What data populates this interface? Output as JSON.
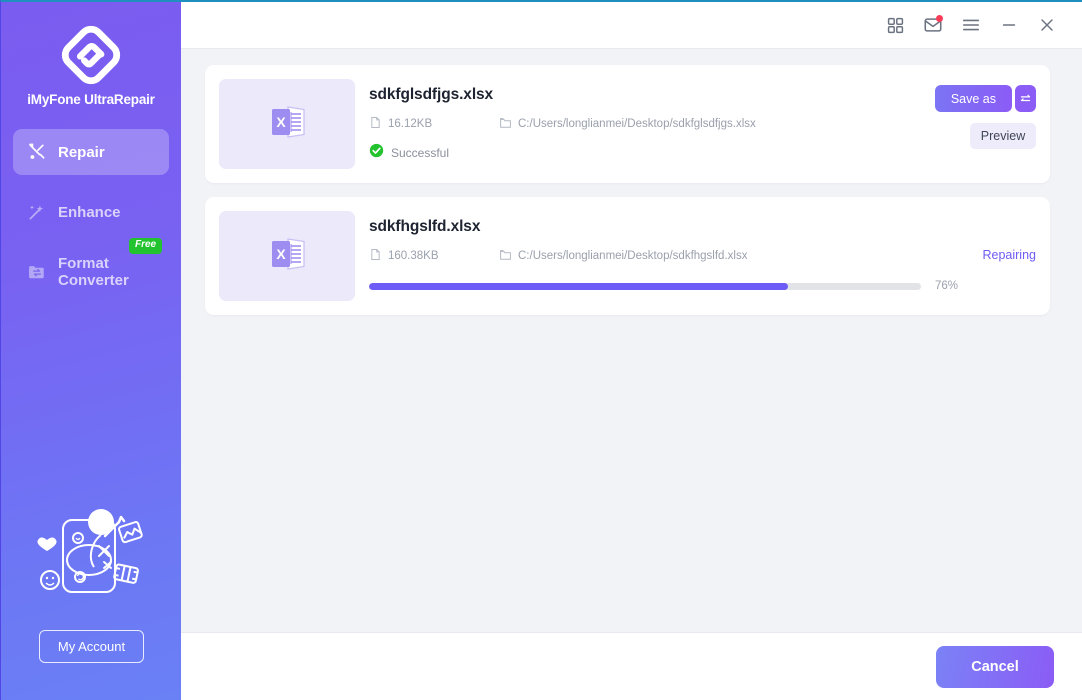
{
  "app": {
    "brand": "iMyFone UltraRepair",
    "logo_icon": "diamond-key-logo-icon"
  },
  "sidebar": {
    "items": [
      {
        "label": "Repair",
        "icon": "wrench-screwdriver-icon",
        "active": true,
        "badge": null
      },
      {
        "label": "Enhance",
        "icon": "magic-wand-icon",
        "active": false,
        "badge": null
      },
      {
        "label": "Format Converter",
        "icon": "folder-swap-icon",
        "active": false,
        "badge": "Free"
      }
    ],
    "promo_illustration": "person-with-device-illustration",
    "account_button": "My Account"
  },
  "titlebar": {
    "buttons": [
      {
        "name": "grid-apps-icon",
        "label": ""
      },
      {
        "name": "mail-icon",
        "label": "",
        "has_notification": true
      },
      {
        "name": "hamburger-menu-icon",
        "label": ""
      },
      {
        "name": "minimize-icon",
        "label": ""
      },
      {
        "name": "close-icon",
        "label": ""
      }
    ]
  },
  "files": [
    {
      "name": "sdkfglsdfjgs.xlsx",
      "size": "16.12KB",
      "path": "C:/Users/longlianmei/Desktop/sdkfglsdfjgs.xlsx",
      "type_icon": "excel-file-icon",
      "state": "done",
      "status_text": "Successful",
      "status_icon": "check-circle-icon",
      "save_as_label": "Save as",
      "swap_icon": "swap-arrows-icon",
      "preview_label": "Preview"
    },
    {
      "name": "sdkfhgslfd.xlsx",
      "size": "160.38KB",
      "path": "C:/Users/longlianmei/Desktop/sdkfhgslfd.xlsx",
      "type_icon": "excel-file-icon",
      "state": "repairing",
      "status_text": "Repairing",
      "progress_percent": 76,
      "progress_label": "76%"
    }
  ],
  "footer": {
    "cancel_label": "Cancel"
  },
  "colors": {
    "sidebar_gradient_start": "#7b5cf0",
    "sidebar_gradient_end": "#6a80f5",
    "accent_purple": "#6d5cf5",
    "button_gradient_start": "#7b82f6",
    "button_gradient_end": "#8b5cf6",
    "success_green": "#22c32e",
    "free_badge_green": "#22c32e",
    "notification_red": "#fb3b57",
    "content_bg": "#f2f3f7",
    "card_bg": "#ffffff",
    "thumb_bg": "#ece9fb",
    "muted_text": "#9aa0ac",
    "title_text": "#1d2330",
    "titlebar_accent": "#1f8fbf"
  }
}
